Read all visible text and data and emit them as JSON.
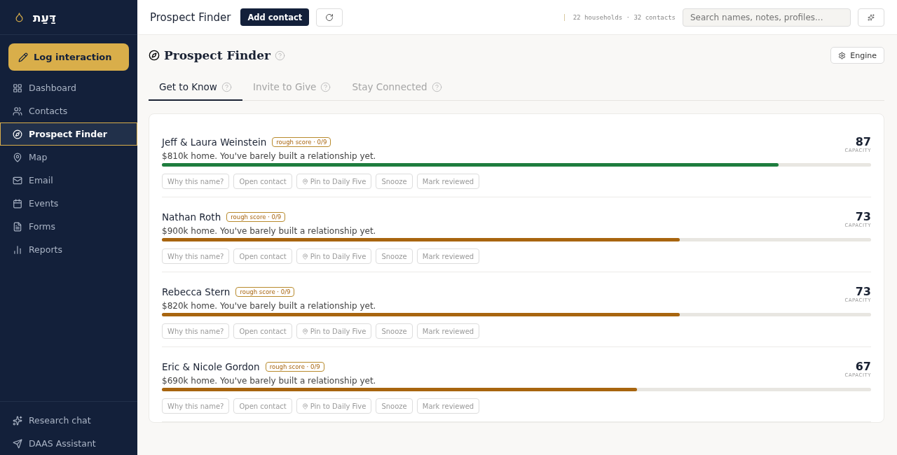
{
  "brand": {
    "name": "דַּעַת"
  },
  "sidebar": {
    "primary_action": "Log interaction",
    "items": [
      {
        "label": "Dashboard",
        "selected": false
      },
      {
        "label": "Contacts",
        "selected": false
      },
      {
        "label": "Prospect Finder",
        "selected": true
      },
      {
        "label": "Map",
        "selected": false
      },
      {
        "label": "Email",
        "selected": false
      },
      {
        "label": "Events",
        "selected": false
      },
      {
        "label": "Forms",
        "selected": false
      },
      {
        "label": "Reports",
        "selected": false
      }
    ],
    "footer_items": [
      {
        "label": "Research chat"
      },
      {
        "label": "DAAS Assistant"
      }
    ]
  },
  "header": {
    "title": "Prospect Finder",
    "add_button": "Add contact",
    "stats": "22 households · 32 contacts",
    "search": {
      "placeholder": "Search names, notes, profiles..."
    }
  },
  "page": {
    "title": "Prospect Finder",
    "engine_button": "Engine",
    "tabs": [
      {
        "label": "Get to Know",
        "selected": true
      },
      {
        "label": "Invite to Give",
        "selected": false
      },
      {
        "label": "Stay Connected",
        "selected": false
      }
    ],
    "prospects": [
      {
        "name": "Jeff & Laura Weinstein",
        "badge": "rough score · 0/9",
        "summary": "$810k home. You've barely built a relationship yet.",
        "score": "87",
        "score_label": "CAPACITY",
        "level": 0.87,
        "color": "#1e7d3e",
        "actions": [
          "Why this name?",
          "Open contact",
          "Pin to Daily Five",
          "Snooze",
          "Mark reviewed"
        ]
      },
      {
        "name": "Nathan Roth",
        "badge": "rough score · 0/9",
        "summary": "$900k home. You've barely built a relationship yet.",
        "score": "73",
        "score_label": "CAPACITY",
        "level": 0.73,
        "color": "#a8650f",
        "actions": [
          "Why this name?",
          "Open contact",
          "Pin to Daily Five",
          "Snooze",
          "Mark reviewed"
        ]
      },
      {
        "name": "Rebecca Stern",
        "badge": "rough score · 0/9",
        "summary": "$820k home. You've barely built a relationship yet.",
        "score": "73",
        "score_label": "CAPACITY",
        "level": 0.73,
        "color": "#a8650f",
        "actions": [
          "Why this name?",
          "Open contact",
          "Pin to Daily Five",
          "Snooze",
          "Mark reviewed"
        ]
      },
      {
        "name": "Eric & Nicole Gordon",
        "badge": "rough score · 0/9",
        "summary": "$690k home. You've barely built a relationship yet.",
        "score": "67",
        "score_label": "CAPACITY",
        "level": 0.67,
        "color": "#a8650f",
        "actions": [
          "Why this name?",
          "Open contact",
          "Pin to Daily Five",
          "Snooze",
          "Mark reviewed"
        ]
      }
    ]
  }
}
